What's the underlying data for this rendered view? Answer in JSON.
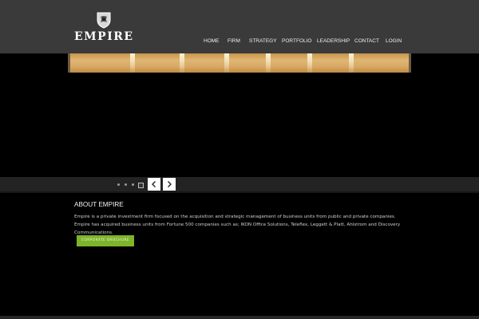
{
  "brand": {
    "name": "EMPIRE"
  },
  "nav": {
    "items": [
      "HOME",
      "FIRM",
      "STRATEGY",
      "PORTFOLIO",
      "LEADERSHIP",
      "CONTACT",
      "LOGIN"
    ]
  },
  "slider": {
    "dots": 4,
    "active_dot": 4,
    "prev_icon": "chevron-left-icon",
    "next_icon": "chevron-right-icon"
  },
  "about": {
    "title": "ABOUT EMPIRE",
    "body": "Empire is a private investment firm focused on the acquisition and strategic management of business units from public and private companies. Empire has acquired business units from Fortune 500 companies such as; IKON Office Solutions, Teleflex, Leggett & Platt, Ahlstrom and Discovery Communications.",
    "cta_label": "CORPORATE BROCHURE"
  },
  "colors": {
    "header_bg": "#3a3a3a",
    "accent": "#7db42a",
    "page_bg": "#000000"
  }
}
